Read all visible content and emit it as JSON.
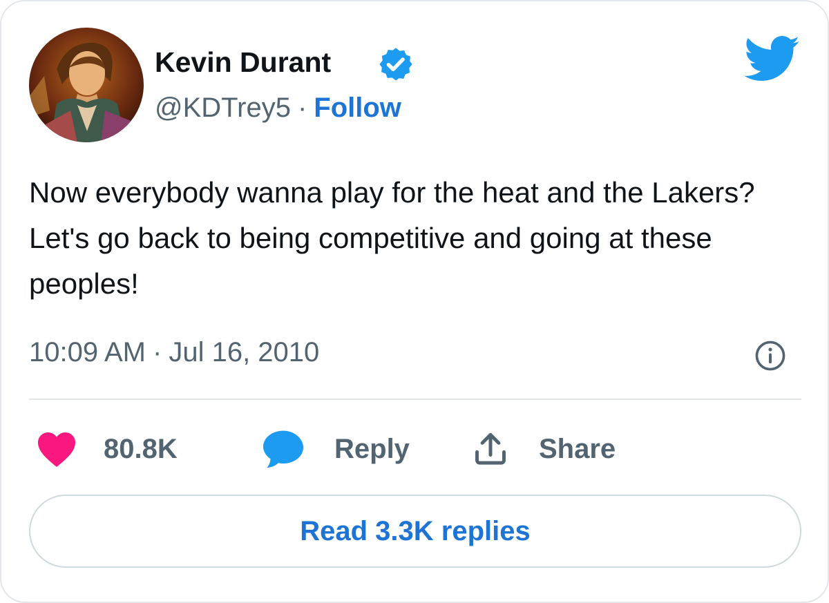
{
  "author": {
    "display_name": "Kevin Durant",
    "handle": "@KDTrey5",
    "separator": "·",
    "follow_label": "Follow",
    "verified": true,
    "avatar_icon": "avatar-illustration"
  },
  "tweet": {
    "text": "Now everybody wanna play for the heat and the Lakers? Let's go back to being competitive and going at these peoples!",
    "time": "10:09 AM",
    "separator": "·",
    "date": "Jul 16, 2010"
  },
  "actions": {
    "like_count": "80.8K",
    "reply_label": "Reply",
    "share_label": "Share"
  },
  "footer": {
    "read_replies_label": "Read 3.3K replies"
  },
  "icons": {
    "brand": "twitter-bird-icon",
    "verified": "verified-badge-icon",
    "info": "info-icon",
    "like": "heart-icon",
    "reply": "speech-bubble-icon",
    "share": "share-arrow-icon"
  },
  "colors": {
    "brand_blue": "#1d9bf0",
    "link_blue": "#1d74d5",
    "like_pink": "#f91880",
    "text_primary": "#0f1419",
    "text_secondary": "#536471"
  }
}
